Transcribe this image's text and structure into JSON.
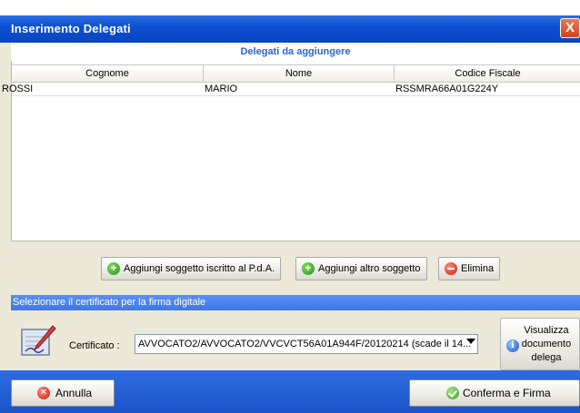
{
  "window": {
    "title": "Inserimento Delegati",
    "close_glyph": "X"
  },
  "grid": {
    "caption": "Delegati da aggiungere",
    "columns": [
      "Cognome",
      "Nome",
      "Codice Fiscale"
    ],
    "rows": [
      [
        "ROSSI",
        "MARIO",
        "RSSMRA66A01G224Y"
      ]
    ]
  },
  "actions": {
    "add_registered": "Aggiungi soggetto iscritto al P.d.A.",
    "add_other": "Aggiungi altro soggetto",
    "delete": "Elimina"
  },
  "certificate": {
    "section_title": "Selezionare il certificato per la firma digitale",
    "label": "Certificato :",
    "selected": "AVVOCATO2/AVVOCATO2/VVCVCT56A01A944F/20120214 (scade il 14...",
    "view_button": [
      "Visualizza",
      "documento",
      "delega"
    ]
  },
  "footer": {
    "cancel": "Annulla",
    "confirm": "Conferma e Firma"
  },
  "colors": {
    "titlebar": "#0b4fd1",
    "caption_text": "#2a63d3",
    "section_header": "#3f77e7",
    "footer": "#1b54c9"
  },
  "icons": {
    "add": "green-plus-icon",
    "delete": "red-minus-icon",
    "info": "info-icon",
    "sign": "signature-pen-icon",
    "cancel": "red-x-icon",
    "confirm": "green-check-icon"
  }
}
